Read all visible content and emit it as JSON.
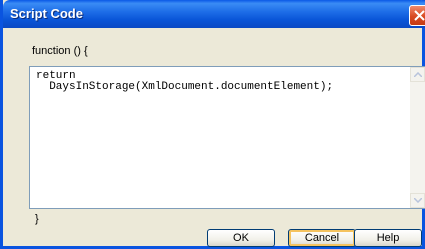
{
  "window": {
    "title": "Script Code"
  },
  "editor": {
    "header": "function () {",
    "code": "return\n  DaysInStorage(XmlDocument.documentElement);",
    "footer": "}"
  },
  "buttons": {
    "ok": "OK",
    "cancel": "Cancel",
    "help": "Help"
  },
  "icons": {
    "close": "close-icon",
    "scroll_up": "scroll-up-arrow-icon",
    "scroll_down": "scroll-down-arrow-icon"
  },
  "colors": {
    "titlebar": "#0a55d8",
    "close_button": "#d84a22",
    "dialog_background": "#ece9d8",
    "editor_border": "#7f9db9"
  }
}
